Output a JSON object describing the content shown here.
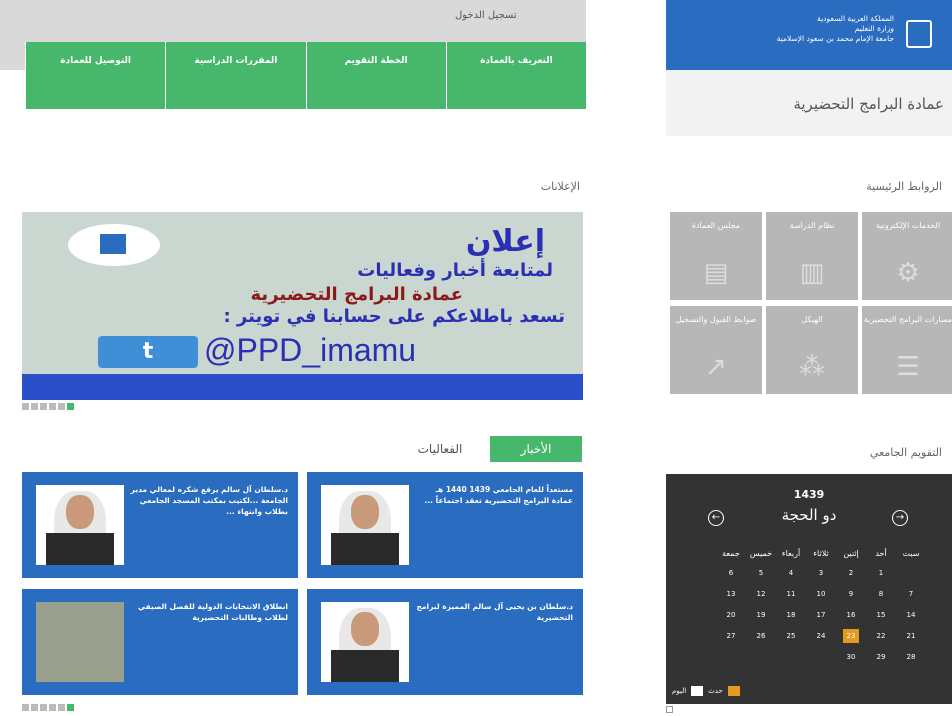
{
  "top_bar": {
    "login": "تسجيل الدخول"
  },
  "nav": [
    "التعريف بالعمادة",
    "الخطة التقويم",
    "المقررات الدراسية",
    "التوصيل للعمادة"
  ],
  "header": {
    "institution_lines": [
      "المملكة العربية السعودية",
      "وزارة التعليم",
      "جامعة الإمام محمد بن سعود الإسلامية"
    ],
    "deanship_name": "عمادة البرامج التحضيرية"
  },
  "sections": {
    "main_links": "الروابط الرئيسية",
    "announcements": "الإعلانات",
    "calendar": "التقويم الجامعي"
  },
  "tiles": [
    {
      "label": "الخدمات الإلكترونية",
      "icon": "gears-icon"
    },
    {
      "label": "نظام الدراسة",
      "icon": "books-icon"
    },
    {
      "label": "مجلس العمادة",
      "icon": "document-icon"
    },
    {
      "label": "مسارات البرامج التحضيرية",
      "icon": "list-icon"
    },
    {
      "label": "الهيكل",
      "icon": "org-chart-icon"
    },
    {
      "label": "ضوابط القبول والتسجيل",
      "icon": "chart-up-icon"
    }
  ],
  "banner": {
    "title": "إعلان",
    "line1": "لمتابعة أخبار وفعاليات",
    "line2": "عمادة البرامج التحضيرية",
    "line3": "تسعد باطلاعكم على حسابنا في تويتر :",
    "handle": "@PPD_imamu",
    "twitter_glyph": "t"
  },
  "tabs": {
    "news": "الأخبار",
    "events": "الفعاليات"
  },
  "news": [
    {
      "title": "مستعداً للعام الجامعي 1439 1440 هـ عمادة البرامج التحضيرية تعقد اجتماعاً ..."
    },
    {
      "title": "د.سلطان آل سالم يرفع شكره لمعالي مدير الجامعة ...لكتيب بمكتب المسجد الجامعي بطلاب وانتهاء ..."
    },
    {
      "title": "د.سلطان بن يحيى آل سالم المميزة لبرامج التحضيرية"
    },
    {
      "title": "انطلاق الانتخابات الدولية للفصل الصيفي لطلاب وطالبات التحضيرية"
    }
  ],
  "calendar": {
    "year": "1439",
    "month": "دو الحجة",
    "prev_glyph": "←",
    "next_glyph": "→",
    "weekdays": [
      "سبت",
      "أحد",
      "إثنين",
      "ثلاثاء",
      "أربعاء",
      "خميس",
      "جمعة"
    ],
    "weeks": [
      [
        "",
        "1",
        "2",
        "3",
        "4",
        "5",
        "6"
      ],
      [
        "7",
        "8",
        "9",
        "10",
        "11",
        "12",
        "13"
      ],
      [
        "14",
        "15",
        "16",
        "17",
        "18",
        "19",
        "20"
      ],
      [
        "21",
        "22",
        "23",
        "24",
        "25",
        "26",
        "27"
      ],
      [
        "28",
        "29",
        "30",
        "",
        "",
        "",
        ""
      ]
    ],
    "today": "23",
    "legend_event": "حدث",
    "legend_today": "اليوم"
  },
  "colors": {
    "green": "#47b86b",
    "blue": "#2a6cc0",
    "tile_grey": "#b7b7b7",
    "today": "#e39a1f"
  }
}
